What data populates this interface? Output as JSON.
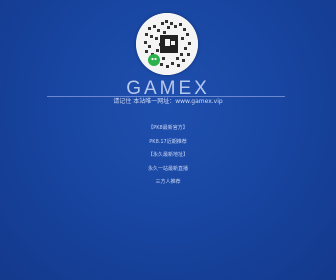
{
  "logo": {
    "icon": "qr-code-icon",
    "badge_icon": "wechat-icon",
    "background": "#f4f4f4"
  },
  "brand": {
    "name": "GAMEX"
  },
  "tagline": {
    "text": "请记住 本站唯一网址：www.gamex.vip"
  },
  "links": [
    {
      "label": "【PK8最新官方】"
    },
    {
      "label": "PK8.17近期推荐"
    },
    {
      "label": "【永久最新地址】"
    },
    {
      "label": "永久一站最新直播"
    },
    {
      "label": "三方人推荐"
    }
  ],
  "colors": {
    "background": "#1846a2",
    "text": "#d2dcf6",
    "badge": "#2bb24c"
  }
}
